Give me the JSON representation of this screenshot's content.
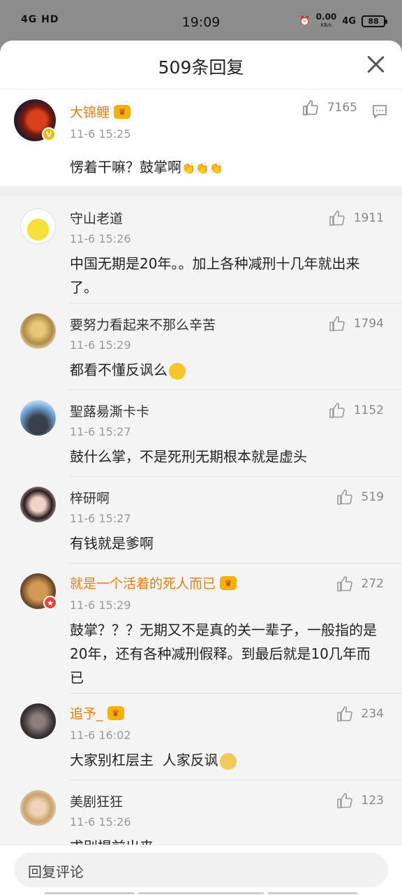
{
  "status_bar": {
    "left_icons": "4G HD",
    "time": "19:09",
    "speed": "0.00",
    "speed_unit": "KB/s",
    "network": "4G",
    "battery": "88"
  },
  "sheet": {
    "title": "509条回复"
  },
  "main_comment": {
    "author": "大锦鲤",
    "time": "11-6 15:25",
    "likes": "7165",
    "text": "愣着干嘛？鼓掌啊"
  },
  "replies": [
    {
      "author": "守山老道",
      "time": "11-6 15:26",
      "likes": "1911",
      "text": " 中国无期是20年。。加上各种减刑十几年就出来了。",
      "vip": false
    },
    {
      "author": "要努力看起来不那么辛苦",
      "time": "11-6 15:29",
      "likes": "1794",
      "text": "都看不懂反讽么",
      "vip": false
    },
    {
      "author": "聖蕗昜澌卡卡",
      "time": "11-6 15:27",
      "likes": "1152",
      "text": "鼓什么掌，不是死刑无期根本就是虚头",
      "vip": false
    },
    {
      "author": "梓研啊",
      "time": "11-6 15:27",
      "likes": "519",
      "text": "有钱就是爹啊",
      "vip": false
    },
    {
      "author": "就是一个活着的死人而已",
      "time": "11-6 15:29",
      "likes": "272",
      "text": "鼓掌？？？无期又不是真的关一辈子，一般指的是20年，还有各种减刑假释。到最后就是10几年而已",
      "vip": true
    },
    {
      "author": "追予_",
      "time": "11-6 16:02",
      "likes": "234",
      "text": "大家别杠层主  人家反讽",
      "vip": true
    },
    {
      "author": "美剧狂狂",
      "time": "11-6 15:26",
      "likes": "123",
      "text": "求别提前出来",
      "vip": false
    }
  ],
  "bottom": {
    "reply_placeholder": "回复评论"
  }
}
